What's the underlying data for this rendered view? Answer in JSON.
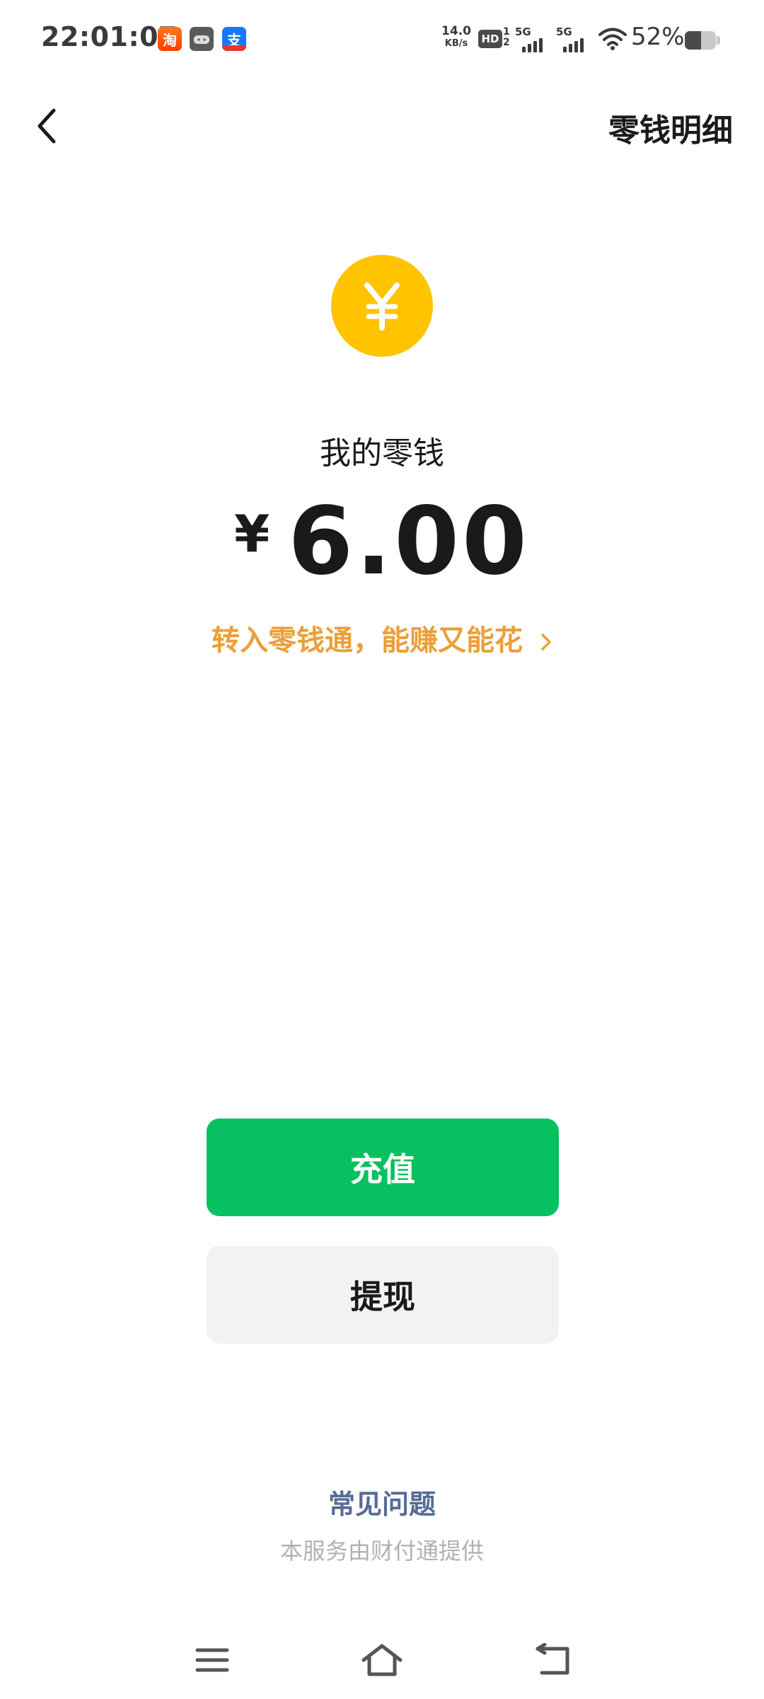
{
  "status_bar": {
    "time": "22:01:07",
    "net_speed_value": "14.0",
    "net_speed_unit": "KB/s",
    "hd_label": "HD",
    "hd_sub_top": "1",
    "hd_sub_bottom": "2",
    "signal1_label": "5G",
    "signal2_label": "5G",
    "battery_percent": "52%",
    "battery_level": 0.52,
    "app_icons": [
      "taobao-icon",
      "game-icon",
      "alipay-icon"
    ]
  },
  "header": {
    "back_icon": "chevron-left-icon",
    "details_label": "零钱明细"
  },
  "balance": {
    "coin_symbol": "¥",
    "label": "我的零钱",
    "currency_sign": "¥",
    "amount": "6.00",
    "promo_text": "转入零钱通，能赚又能花"
  },
  "actions": {
    "recharge_label": "充值",
    "withdraw_label": "提现"
  },
  "footer": {
    "faq_label": "常见问题",
    "provider_note": "本服务由财付通提供"
  },
  "nav_bar": {
    "icons": [
      "menu-icon",
      "home-icon",
      "back-icon"
    ]
  },
  "colors": {
    "primary_green": "#07c160",
    "coin_yellow": "#ffc300",
    "promo_orange": "#eb9f3a",
    "link_blue": "#576b95"
  }
}
